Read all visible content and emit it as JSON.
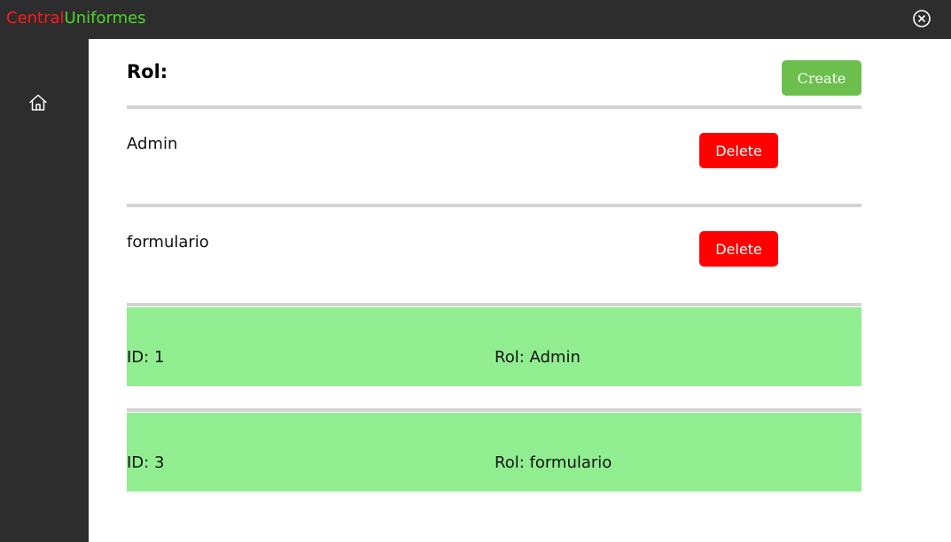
{
  "app": {
    "title_part1": "Central",
    "title_part2": "Uniformes",
    "title_part1_color": "#ff1a1a",
    "title_part2_color": "#4cd62b"
  },
  "titlebar": {
    "close_icon": "close-circle-icon"
  },
  "sidebar": {
    "home_icon": "home-icon"
  },
  "page": {
    "title": "Rol:",
    "create_label": "Create"
  },
  "roles": [
    {
      "name": "Admin",
      "delete_label": "Delete"
    },
    {
      "name": "formulario",
      "delete_label": "Delete"
    }
  ],
  "details": [
    {
      "id_text": "ID: 1",
      "rol_text": "Rol: Admin"
    },
    {
      "id_text": "ID: 3",
      "rol_text": "Rol: formulario"
    }
  ],
  "colors": {
    "chrome": "#2d2d2d",
    "create_button": "#6cbf4d",
    "delete_button": "#ff0000",
    "detail_card": "#90ee90",
    "separator": "#d3d3d3"
  }
}
